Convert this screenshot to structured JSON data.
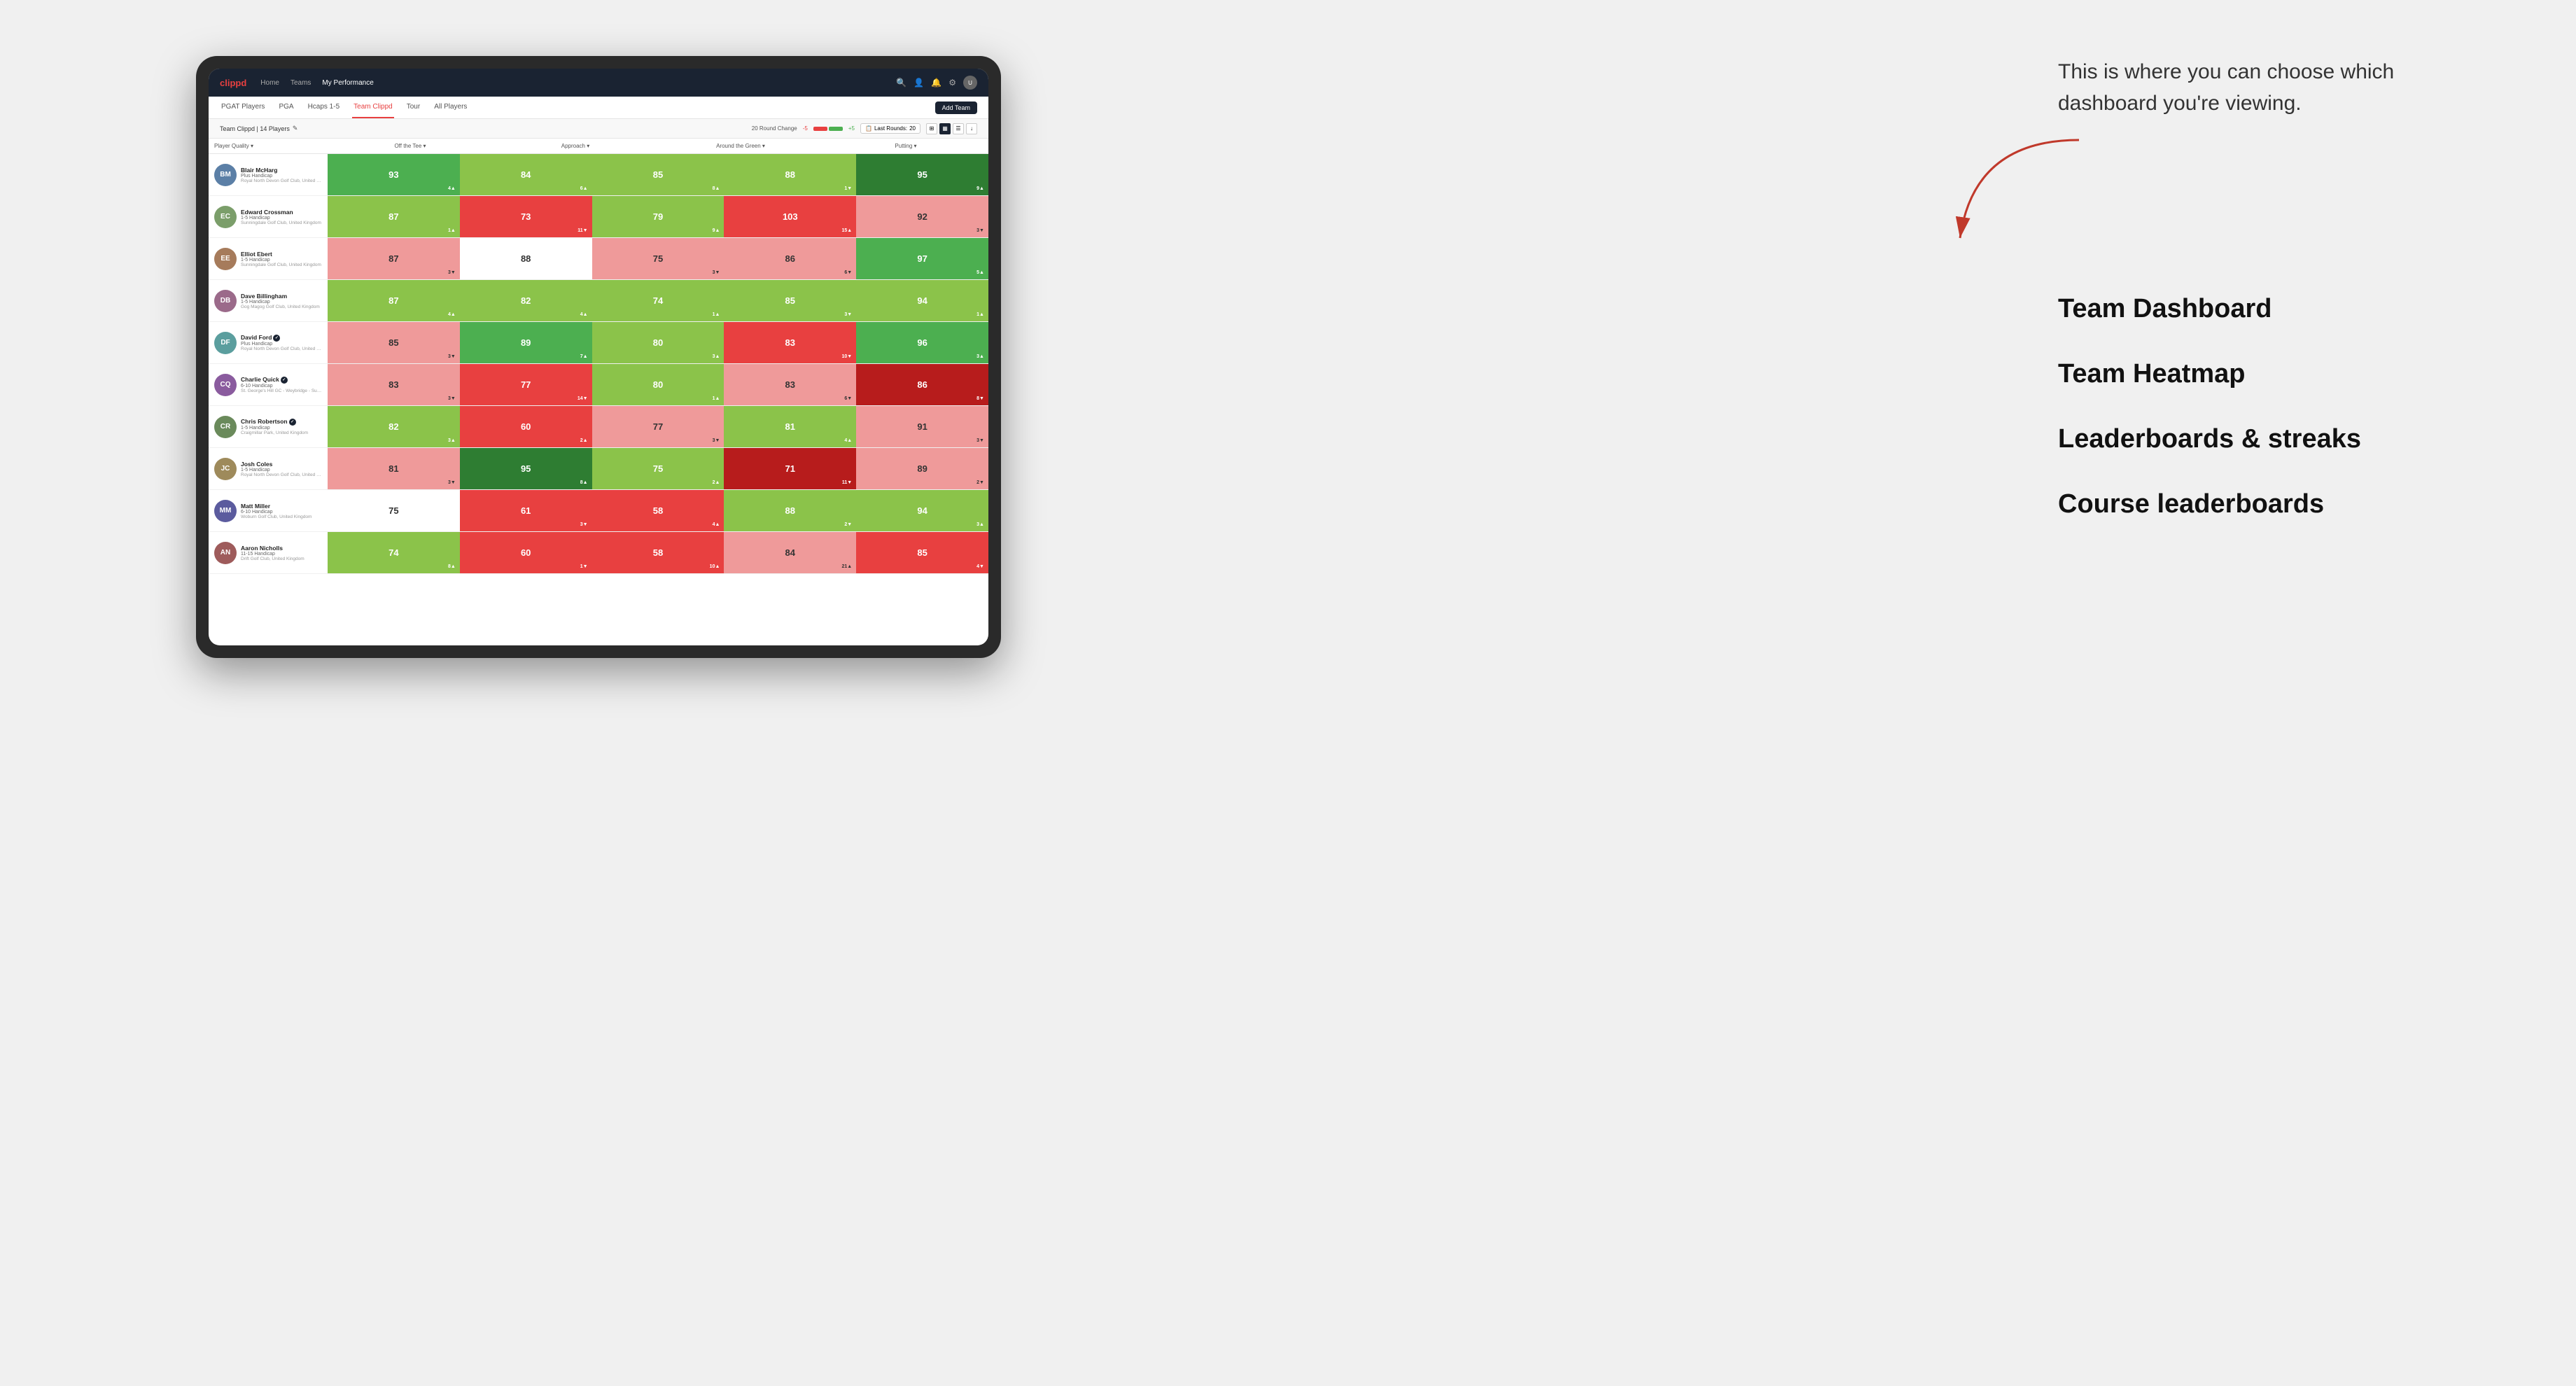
{
  "annotation": {
    "callout": "This is where you can choose which dashboard you're viewing.",
    "options": [
      "Team Dashboard",
      "Team Heatmap",
      "Leaderboards & streaks",
      "Course leaderboards"
    ]
  },
  "nav": {
    "logo": "clippd",
    "links": [
      "Home",
      "Teams",
      "My Performance"
    ],
    "active_link": "My Performance"
  },
  "sub_nav": {
    "tabs": [
      "PGAT Players",
      "PGA",
      "Hcaps 1-5",
      "Team Clippd",
      "Tour",
      "All Players"
    ],
    "active_tab": "Team Clippd",
    "add_team_label": "Add Team"
  },
  "team_header": {
    "name": "Team Clippd | 14 Players",
    "edit_icon": "✎",
    "round_change_label": "20 Round Change",
    "range_minus": "-5",
    "range_plus": "+5",
    "last_rounds_label": "Last Rounds:",
    "last_rounds_value": "20"
  },
  "table": {
    "columns": [
      "Player Quality ▾",
      "Off the Tee ▾",
      "Approach ▾",
      "Around the Green ▾",
      "Putting ▾"
    ],
    "players": [
      {
        "name": "Blair McHarg",
        "handicap": "Plus Handicap",
        "club": "Royal North Devon Golf Club, United Kingdom",
        "badge": false,
        "stats": [
          {
            "value": "93",
            "change": "4▲",
            "color": "green-medium"
          },
          {
            "value": "84",
            "change": "6▲",
            "color": "green-light"
          },
          {
            "value": "85",
            "change": "8▲",
            "color": "green-light"
          },
          {
            "value": "88",
            "change": "1▼",
            "color": "green-light"
          },
          {
            "value": "95",
            "change": "9▲",
            "color": "green-dark"
          }
        ]
      },
      {
        "name": "Edward Crossman",
        "handicap": "1-5 Handicap",
        "club": "Sunningdale Golf Club, United Kingdom",
        "badge": false,
        "stats": [
          {
            "value": "87",
            "change": "1▲",
            "color": "green-light"
          },
          {
            "value": "73",
            "change": "11▼",
            "color": "red-medium"
          },
          {
            "value": "79",
            "change": "9▲",
            "color": "green-light"
          },
          {
            "value": "103",
            "change": "15▲",
            "color": "red-medium"
          },
          {
            "value": "92",
            "change": "3▼",
            "color": "red-light"
          }
        ]
      },
      {
        "name": "Elliot Ebert",
        "handicap": "1-5 Handicap",
        "club": "Sunningdale Golf Club, United Kingdom",
        "badge": false,
        "stats": [
          {
            "value": "87",
            "change": "3▼",
            "color": "red-light"
          },
          {
            "value": "88",
            "change": "",
            "color": "neutral"
          },
          {
            "value": "75",
            "change": "3▼",
            "color": "red-light"
          },
          {
            "value": "86",
            "change": "6▼",
            "color": "red-light"
          },
          {
            "value": "97",
            "change": "5▲",
            "color": "green-medium"
          }
        ]
      },
      {
        "name": "Dave Billingham",
        "handicap": "1-5 Handicap",
        "club": "Gog Magog Golf Club, United Kingdom",
        "badge": false,
        "stats": [
          {
            "value": "87",
            "change": "4▲",
            "color": "green-light"
          },
          {
            "value": "82",
            "change": "4▲",
            "color": "green-light"
          },
          {
            "value": "74",
            "change": "1▲",
            "color": "green-light"
          },
          {
            "value": "85",
            "change": "3▼",
            "color": "green-light"
          },
          {
            "value": "94",
            "change": "1▲",
            "color": "green-light"
          }
        ]
      },
      {
        "name": "David Ford",
        "handicap": "Plus Handicap",
        "club": "Royal North Devon Golf Club, United Kingdom",
        "badge": true,
        "stats": [
          {
            "value": "85",
            "change": "3▼",
            "color": "red-light"
          },
          {
            "value": "89",
            "change": "7▲",
            "color": "green-medium"
          },
          {
            "value": "80",
            "change": "3▲",
            "color": "green-light"
          },
          {
            "value": "83",
            "change": "10▼",
            "color": "red-medium"
          },
          {
            "value": "96",
            "change": "3▲",
            "color": "green-medium"
          }
        ]
      },
      {
        "name": "Charlie Quick",
        "handicap": "6-10 Handicap",
        "club": "St. George's Hill GC - Weybridge - Surrey, Uni...",
        "badge": true,
        "stats": [
          {
            "value": "83",
            "change": "3▼",
            "color": "red-light"
          },
          {
            "value": "77",
            "change": "14▼",
            "color": "red-medium"
          },
          {
            "value": "80",
            "change": "1▲",
            "color": "green-light"
          },
          {
            "value": "83",
            "change": "6▼",
            "color": "red-light"
          },
          {
            "value": "86",
            "change": "8▼",
            "color": "red-dark"
          }
        ]
      },
      {
        "name": "Chris Robertson",
        "handicap": "1-5 Handicap",
        "club": "Craigmillar Park, United Kingdom",
        "badge": true,
        "stats": [
          {
            "value": "82",
            "change": "3▲",
            "color": "green-light"
          },
          {
            "value": "60",
            "change": "2▲",
            "color": "red-medium"
          },
          {
            "value": "77",
            "change": "3▼",
            "color": "red-light"
          },
          {
            "value": "81",
            "change": "4▲",
            "color": "green-light"
          },
          {
            "value": "91",
            "change": "3▼",
            "color": "red-light"
          }
        ]
      },
      {
        "name": "Josh Coles",
        "handicap": "1-5 Handicap",
        "club": "Royal North Devon Golf Club, United Kingdom",
        "badge": false,
        "stats": [
          {
            "value": "81",
            "change": "3▼",
            "color": "red-light"
          },
          {
            "value": "95",
            "change": "8▲",
            "color": "green-dark"
          },
          {
            "value": "75",
            "change": "2▲",
            "color": "green-light"
          },
          {
            "value": "71",
            "change": "11▼",
            "color": "red-dark"
          },
          {
            "value": "89",
            "change": "2▼",
            "color": "red-light"
          }
        ]
      },
      {
        "name": "Matt Miller",
        "handicap": "6-10 Handicap",
        "club": "Woburn Golf Club, United Kingdom",
        "badge": false,
        "stats": [
          {
            "value": "75",
            "change": "",
            "color": "neutral"
          },
          {
            "value": "61",
            "change": "3▼",
            "color": "red-medium"
          },
          {
            "value": "58",
            "change": "4▲",
            "color": "red-medium"
          },
          {
            "value": "88",
            "change": "2▼",
            "color": "green-light"
          },
          {
            "value": "94",
            "change": "3▲",
            "color": "green-light"
          }
        ]
      },
      {
        "name": "Aaron Nicholls",
        "handicap": "11-15 Handicap",
        "club": "Drift Golf Club, United Kingdom",
        "badge": false,
        "stats": [
          {
            "value": "74",
            "change": "8▲",
            "color": "green-light"
          },
          {
            "value": "60",
            "change": "1▼",
            "color": "red-medium"
          },
          {
            "value": "58",
            "change": "10▲",
            "color": "red-medium"
          },
          {
            "value": "84",
            "change": "21▲",
            "color": "red-light"
          },
          {
            "value": "85",
            "change": "4▼",
            "color": "red-medium"
          }
        ]
      }
    ]
  },
  "colors": {
    "brand_red": "#e84040",
    "nav_bg": "#1a2332",
    "green_dark": "#2e7d32",
    "green_medium": "#4caf50",
    "green_light": "#8bc34a",
    "red_dark": "#b71c1c",
    "red_medium": "#e84040",
    "red_light": "#ef9a9a"
  }
}
